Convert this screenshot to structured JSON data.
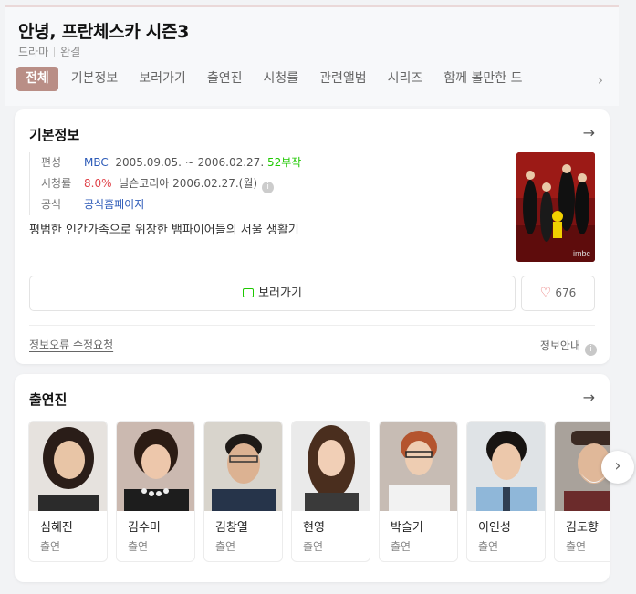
{
  "title": "안녕, 프란체스카 시즌3",
  "meta": {
    "genre": "드라마",
    "status": "완결"
  },
  "tabs": [
    "전체",
    "기본정보",
    "보러가기",
    "출연진",
    "시청률",
    "관련앨범",
    "시리즈",
    "함께 볼만한 드"
  ],
  "basic_info": {
    "heading": "기본정보",
    "broadcast_key": "편성",
    "broadcaster": "MBC",
    "period": "2005.09.05. ~ 2006.02.27.",
    "episodes": "52부작",
    "rating_key": "시청률",
    "rating_value": "8.0%",
    "rating_source": "닐슨코리아 2006.02.27.(월)",
    "official_key": "공식",
    "official_value": "공식홈페이지",
    "description": "평범한 인간가족으로 위장한 뱀파이어들의 서울 생활기",
    "poster_logo": "imbc",
    "watch_label": "보러가기",
    "like_count": "676",
    "error_link": "정보오류 수정요청",
    "guide_label": "정보안내"
  },
  "cast_section": {
    "heading": "출연진",
    "members": [
      {
        "name": "심혜진",
        "role": "출연"
      },
      {
        "name": "김수미",
        "role": "출연"
      },
      {
        "name": "김창열",
        "role": "출연"
      },
      {
        "name": "현영",
        "role": "출연"
      },
      {
        "name": "박슬기",
        "role": "출연"
      },
      {
        "name": "이인성",
        "role": "출연"
      },
      {
        "name": "김도향",
        "role": "출연"
      }
    ]
  },
  "colors": {
    "accent_tab": "#b98e86",
    "link_blue": "#2d5bb8",
    "rating_red": "#e0434a",
    "green": "#1ec800"
  },
  "icons": {
    "forward": "arrow-right-icon",
    "info": "info-icon",
    "heart": "heart-icon",
    "video": "video-icon",
    "next": "chevron-right-icon"
  }
}
